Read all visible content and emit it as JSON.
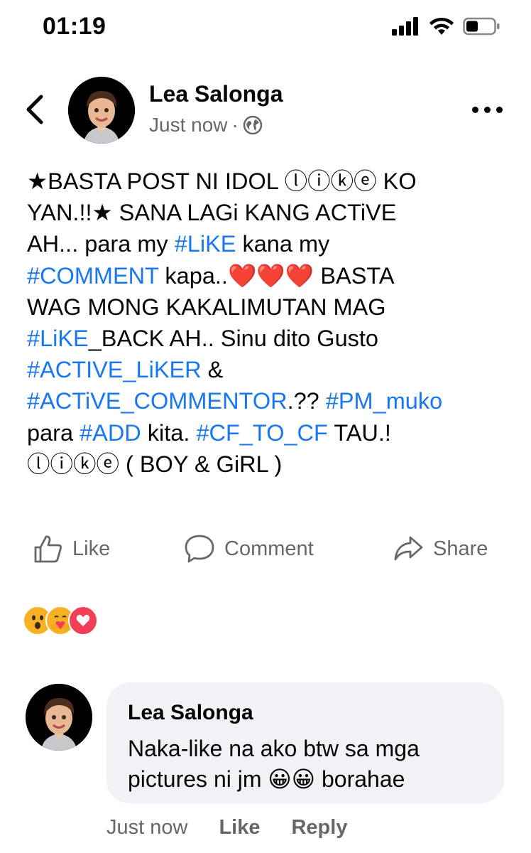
{
  "status_bar": {
    "time": "01:19"
  },
  "post": {
    "author": "Lea Salonga",
    "time": "Just now",
    "separator": "·",
    "body_lines": [
      [
        {
          "t": "★BASTA POST NI IDOL ⓛⓘⓚⓔ KO"
        }
      ],
      [
        {
          "t": "YAN.!!★ SANA LAGi KANG ACTiVE"
        }
      ],
      [
        {
          "t": "AH... para my "
        },
        {
          "t": "#LiKE",
          "h": true
        },
        {
          "t": " kana my"
        }
      ],
      [
        {
          "t": "#COMMENT",
          "h": true
        },
        {
          "t": " kapa..❤️❤️❤️ BASTA"
        }
      ],
      [
        {
          "t": "WAG MONG KAKALIMUTAN MAG"
        }
      ],
      [
        {
          "t": "#LiKE",
          "h": true
        },
        {
          "t": "_BACK AH.. Sinu dito Gusto"
        }
      ],
      [
        {
          "t": "#ACTIVE_LiKER",
          "h": true
        },
        {
          "t": " &"
        }
      ],
      [
        {
          "t": "#ACTiVE_COMMENTOR",
          "h": true
        },
        {
          "t": ".?? "
        },
        {
          "t": "#PM_muko",
          "h": true
        }
      ],
      [
        {
          "t": "para "
        },
        {
          "t": "#ADD",
          "h": true
        },
        {
          "t": " kita. "
        },
        {
          "t": "#CF_TO_CF",
          "h": true
        },
        {
          "t": " TAU.!"
        }
      ],
      [
        {
          "t": "ⓛⓘⓚⓔ ( BOY & GiRL )"
        }
      ]
    ],
    "actions": {
      "like": "Like",
      "comment": "Comment",
      "share": "Share"
    },
    "reactions": [
      "wow-icon",
      "care-icon",
      "love-icon"
    ]
  },
  "comment": {
    "author": "Lea Salonga",
    "text": "Naka-like na ako btw sa mga pictures ni jm 😀😀 borahae",
    "time": "Just now",
    "like": "Like",
    "reply": "Reply"
  },
  "colors": {
    "hashtag": "#1877f2",
    "meta": "#65676b",
    "bubble": "#f0f2f5"
  }
}
